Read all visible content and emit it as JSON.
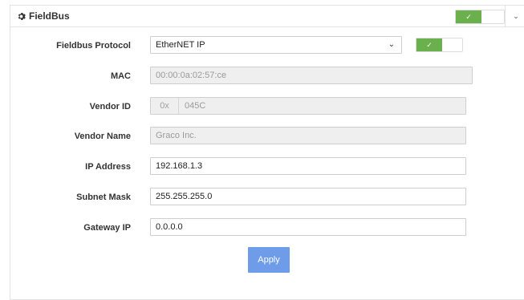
{
  "panel": {
    "title": "FieldBus",
    "header_toggle_state": "on",
    "toggle_check": "✓",
    "collapse_icon": "⌄"
  },
  "form": {
    "protocol": {
      "label": "Fieldbus Protocol",
      "value": "EtherNET IP",
      "toggle_state": "on"
    },
    "mac": {
      "label": "MAC",
      "value": "00:00:0a:02:57:ce"
    },
    "vendor_id": {
      "label": "Vendor ID",
      "prefix": "0x",
      "value": "045C"
    },
    "vendor_name": {
      "label": "Vendor Name",
      "value": "Graco Inc."
    },
    "ip_address": {
      "label": "IP Address",
      "value": "192.168.1.3"
    },
    "subnet_mask": {
      "label": "Subnet Mask",
      "value": "255.255.255.0"
    },
    "gateway_ip": {
      "label": "Gateway IP",
      "value": "0.0.0.0"
    }
  },
  "actions": {
    "apply_label": "Apply"
  },
  "colors": {
    "toggle_on": "#6ab04c",
    "apply": "#6f9ce8"
  }
}
